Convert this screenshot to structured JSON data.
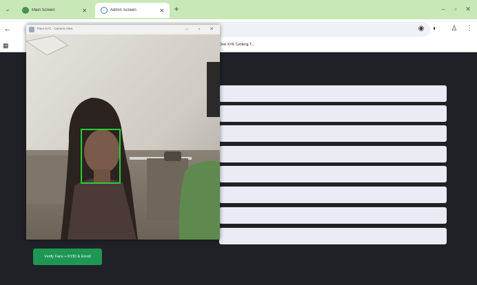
{
  "browser": {
    "tabs": [
      {
        "title": "Main Screen",
        "active": false
      },
      {
        "title": "Admin Screen",
        "active": true
      }
    ],
    "bookmark_item": "Over KYE Centeng T...",
    "popup_title": "Face KYC - Camera View"
  },
  "page": {
    "form_field_count": 8,
    "verify_button_label": "Verify Face + KYID & Enroll"
  },
  "colors": {
    "tab_strip": "#c9e8b7",
    "page_background": "#1f2126",
    "field_background": "#e9ecf5",
    "button_green": "#1e9654",
    "face_box": "#27d035"
  },
  "icons": {
    "back": "arrow-left-icon",
    "info": "info-icon",
    "extensions": "extension-icon",
    "profile": "profile-icon",
    "menu": "kebab-menu-icon"
  }
}
